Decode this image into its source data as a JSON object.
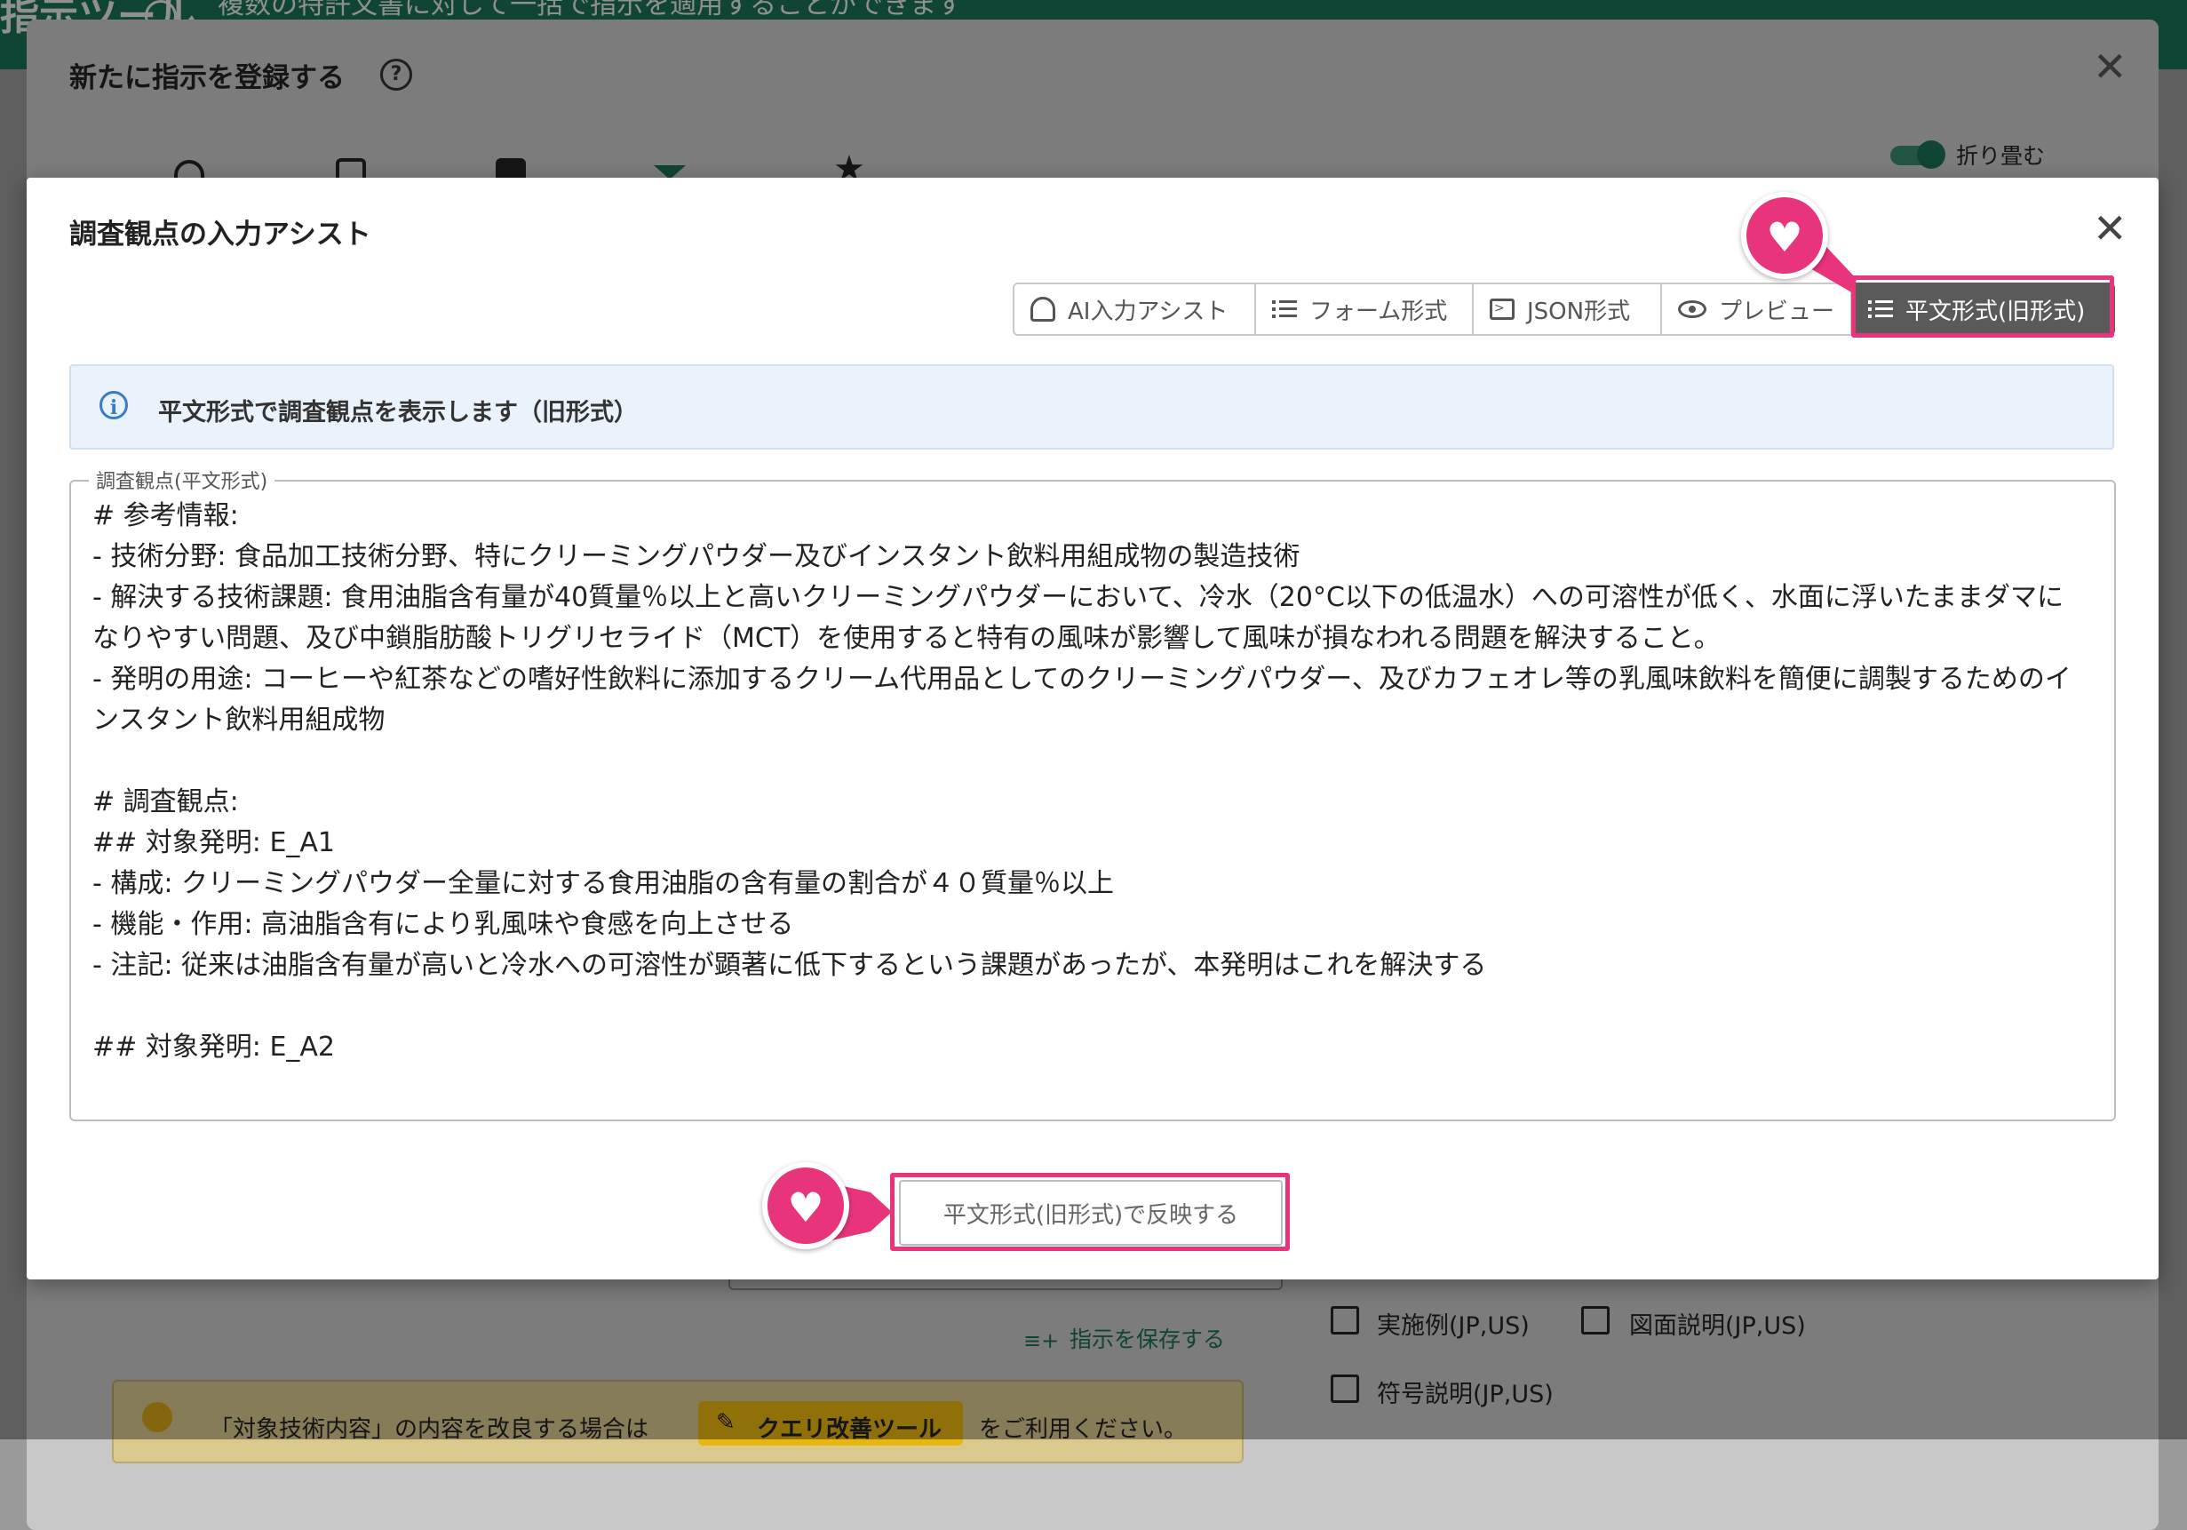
{
  "app": {
    "header_title": "指示ツール",
    "header_subtitle": "複数の特許文書に対して一括で指示を適用することができます"
  },
  "back_dialog": {
    "title": "新たに指示を登録する",
    "help_icon": "question-circle-icon",
    "close_icon": "close-icon",
    "toggle_label": "折り畳む",
    "toggle_on": true,
    "step_icons": [
      "target-icon",
      "copy-icon",
      "document-stack-icon",
      "filter-icon",
      "star-icon"
    ]
  },
  "background": {
    "save_instruction_label": "指示を保存する",
    "checkboxes": [
      {
        "label": "実施例(JP,US)",
        "checked": false
      },
      {
        "label": "図面説明(JP,US)",
        "checked": false
      },
      {
        "label": "符号説明(JP,US)",
        "checked": false
      }
    ],
    "tip": {
      "text_before": "「対象技術内容」の内容を改良する場合は",
      "button_label": "クエリ改善ツール",
      "text_after": "をご利用ください。"
    }
  },
  "dialog": {
    "title": "調査観点の入力アシスト",
    "close_icon": "close-icon",
    "tabs": [
      {
        "label": "AI入力アシスト",
        "icon": "ai-assist-icon",
        "active": false
      },
      {
        "label": "フォーム形式",
        "icon": "list-icon",
        "active": false
      },
      {
        "label": "JSON形式",
        "icon": "terminal-icon",
        "active": false
      },
      {
        "label": "プレビュー",
        "icon": "eye-icon",
        "active": false
      },
      {
        "label": "平文形式(旧形式)",
        "icon": "list-icon",
        "active": true
      }
    ],
    "alert_text": "平文形式で調査観点を表示します（旧形式）",
    "textarea_label": "調査観点(平文形式)",
    "textarea_value": "# 参考情報:\n- 技術分野: 食品加工技術分野、特にクリーミングパウダー及びインスタント飲料用組成物の製造技術\n- 解決する技術課題: 食用油脂含有量が40質量％以上と高いクリーミングパウダーにおいて、冷水（20°C以下の低温水）への可溶性が低く、水面に浮いたままダマになりやすい問題、及び中鎖脂肪酸トリグリセライド（MCT）を使用すると特有の風味が影響して風味が損なわれる問題を解決すること。\n- 発明の用途: コーヒーや紅茶などの嗜好性飲料に添加するクリーム代用品としてのクリーミングパウダー、及びカフェオレ等の乳風味飲料を簡便に調製するためのインスタント飲料用組成物\n\n# 調査観点:\n## 対象発明: E_A1\n- 構成: クリーミングパウダー全量に対する食用油脂の含有量の割合が４０質量％以上\n- 機能・作用: 高油脂含有により乳風味や食感を向上させる\n- 注記: 従来は油脂含有量が高いと冷水への可溶性が顕著に低下するという課題があったが、本発明はこれを解決する\n\n## 対象発明: E_A2",
    "reflect_button_label": "平文形式(旧形式)で反映する"
  },
  "annotations": {
    "highlight_color": "#e8347a",
    "marker_icon": "heart-icon"
  },
  "colors": {
    "brand": "#1b6e55",
    "active_tab": "#5a5a5a",
    "alert_bg": "#eaf2fb",
    "info": "#3a7bc8"
  }
}
